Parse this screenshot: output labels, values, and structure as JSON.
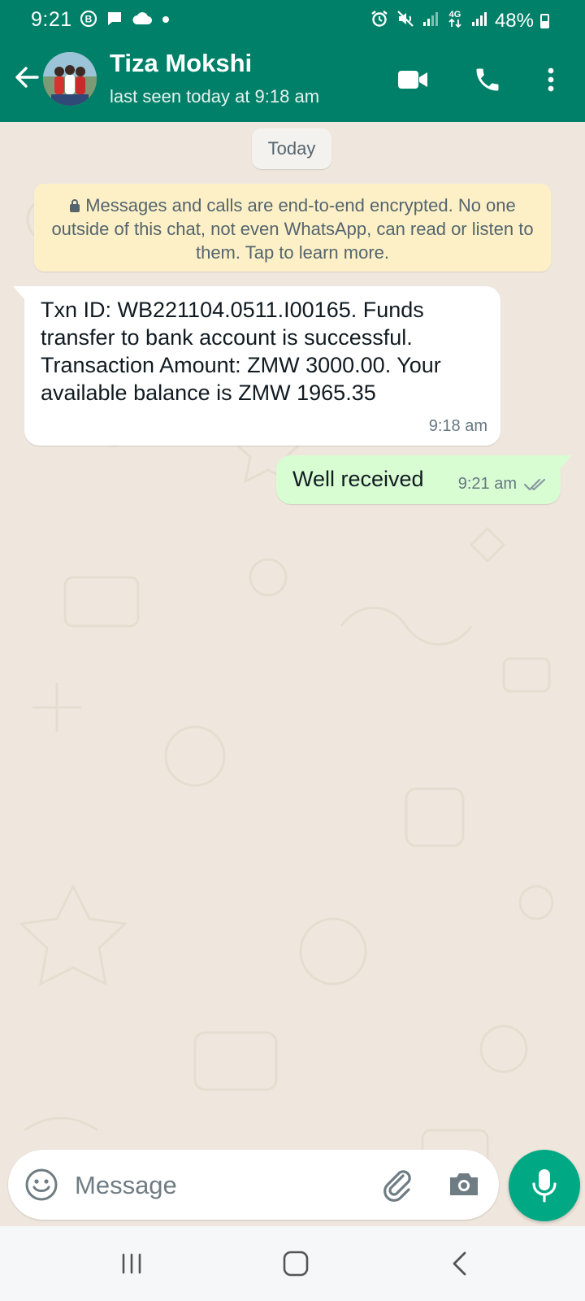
{
  "status_bar": {
    "time": "9:21",
    "battery": "48%",
    "network": "4G"
  },
  "header": {
    "contact_name": "Tiza Mokshi",
    "last_seen": "last seen today at 9:18 am"
  },
  "chat": {
    "date_chip": "Today",
    "encryption_notice": "Messages and calls are end-to-end encrypted. No one outside of this chat, not even WhatsApp, can read or listen to them. Tap to learn more.",
    "messages": [
      {
        "direction": "incoming",
        "text": "Txn ID: WB221104.0511.I00165. Funds transfer to bank account is successful. Transaction Amount: ZMW 3000.00. Your available balance is ZMW 1965.35",
        "time": "9:18 am"
      },
      {
        "direction": "outgoing",
        "text": "Well received",
        "time": "9:21 am",
        "status": "read"
      }
    ]
  },
  "composer": {
    "placeholder": "Message"
  },
  "colors": {
    "header": "#008069",
    "chat_bg": "#efe7dd",
    "outgoing_bubble": "#d9fdd3",
    "incoming_bubble": "#ffffff",
    "notice_bg": "#fdf0c6",
    "mic_button": "#00a884",
    "read_ticks": "#8696a0"
  }
}
